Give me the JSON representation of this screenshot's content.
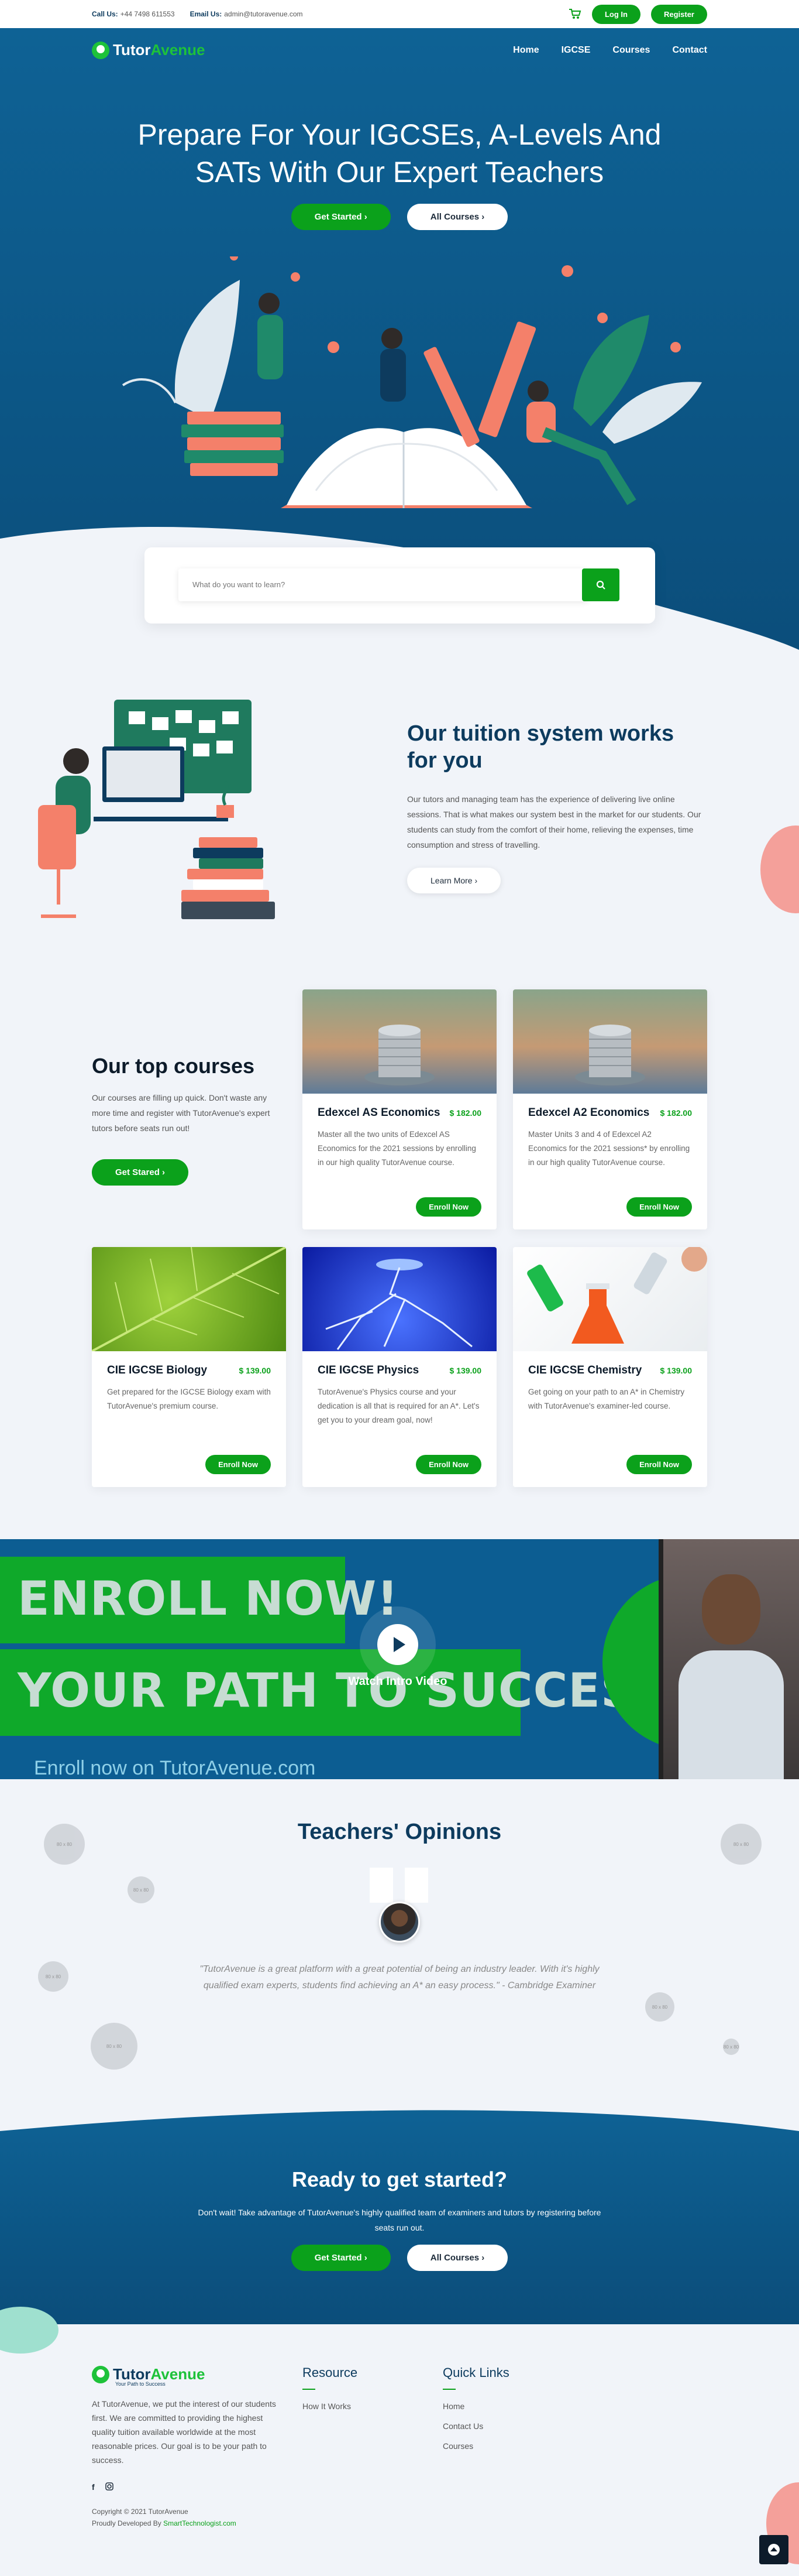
{
  "topbar": {
    "call_label": "Call Us:",
    "call_value": "+44 7498 611553",
    "email_label": "Email Us:",
    "email_value": "admin@tutoravenue.com",
    "login": "Log In",
    "register": "Register"
  },
  "brand": {
    "part1": "Tutor",
    "part2": "Avenue",
    "tagline": "Your Path to Success"
  },
  "nav": [
    "Home",
    "IGCSE",
    "Courses",
    "Contact"
  ],
  "hero": {
    "title_line1": "Prepare For Your IGCSEs, A-Levels And",
    "title_line2": "SATs With Our Expert Teachers",
    "cta_primary": "Get Started",
    "cta_secondary": "All Courses"
  },
  "search": {
    "placeholder": "What do you want to learn?"
  },
  "tuition": {
    "title": "Our tuition system works for you",
    "text": "Our tutors and managing team has the experience of delivering live online sessions. That is what makes our system best in the market for our students. Our students can study from the comfort of their home, relieving the expenses, time consumption and stress of travelling.",
    "button": "Learn More"
  },
  "courses": {
    "title": "Our top courses",
    "text": "Our courses are filling up quick. Don't waste any more time and register with TutorAvenue's expert tutors before seats run out!",
    "button": "Get Stared",
    "enroll_label": "Enroll Now",
    "items": [
      {
        "title": "Edexcel AS Economics",
        "price": "$ 182.00",
        "text": "Master all the two units of Edexcel AS Economics for the 2021 sessions by enrolling in our high quality TutorAvenue course."
      },
      {
        "title": "Edexcel A2 Economics",
        "price": "$ 182.00",
        "text": "Master Units 3 and 4 of Edexcel A2 Economics for the 2021 sessions* by enrolling in our high quality TutorAvenue course."
      },
      {
        "title": "CIE IGCSE Biology",
        "price": "$ 139.00",
        "text": "Get prepared for the IGCSE Biology exam with TutorAvenue's premium course."
      },
      {
        "title": "CIE IGCSE Physics",
        "price": "$ 139.00",
        "text": "TutorAvenue's Physics course and your dedication is all that is required for an A*. Let's get you to your dream goal, now!"
      },
      {
        "title": "CIE IGCSE Chemistry",
        "price": "$ 139.00",
        "text": "Get going on your path to an A* in Chemistry with TutorAvenue's examiner-led course."
      }
    ]
  },
  "video": {
    "line1": "ENROLL NOW!",
    "line2": "YOUR PATH TO SUCCESS",
    "sub": "Enroll now on TutorAvenue.com",
    "watch": "Watch Intro Video"
  },
  "testimonials": {
    "title": "Teachers' Opinions",
    "quote": "\"TutorAvenue is a great platform with a great potential of being an industry leader. With it's highly qualified exam experts, students find achieving an A* an easy process.\" - Cambridge Examiner",
    "bubble_label": "80 x 80"
  },
  "cta": {
    "title": "Ready to get started?",
    "text": "Don't wait! Take advantage of TutorAvenue's highly qualified team of examiners and tutors by registering before seats run out.",
    "primary": "Get Started",
    "secondary": "All Courses"
  },
  "footer": {
    "about": "At TutorAvenue, we put the interest of our students first. We are committed to providing the highest quality tuition available worldwide at the most reasonable prices. Our goal is to be your path to success.",
    "resource_title": "Resource",
    "resource_links": [
      "How It Works"
    ],
    "quick_title": "Quick Links",
    "quick_links": [
      "Home",
      "Contact Us",
      "Courses"
    ],
    "copyright": "Copyright © 2021 TutorAvenue",
    "developed": "Proudly Developed By",
    "developer": "SmartTechnologist.com"
  },
  "colors": {
    "primary_blue": "#0e6295",
    "accent_green": "#0ba11b",
    "dark_navy": "#0d3b5e",
    "coral": "#f4806a"
  }
}
